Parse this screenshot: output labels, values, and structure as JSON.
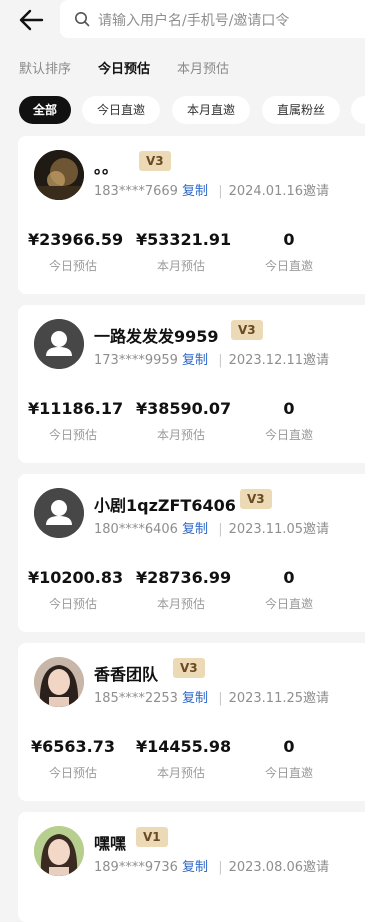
{
  "header": {
    "search_placeholder": "请输入用户名/手机号/邀请口令"
  },
  "sort_tabs": [
    {
      "label": "默认排序",
      "active": false
    },
    {
      "label": "今日预估",
      "active": true
    },
    {
      "label": "本月预估",
      "active": false
    }
  ],
  "filter_chips": [
    {
      "label": "全部",
      "active": true
    },
    {
      "label": "今日直邀",
      "active": false
    },
    {
      "label": "本月直邀",
      "active": false
    },
    {
      "label": "直属粉丝",
      "active": false
    }
  ],
  "copy_label": "复制",
  "stat_labels": [
    "今日预估",
    "本月预估",
    "今日直邀"
  ],
  "members": [
    {
      "name": "。。",
      "level": "V3",
      "phone": "183****7669",
      "invite_date": "2024.01.16邀请",
      "avatar": "dark-photo",
      "stats": [
        "¥23966.59",
        "¥53321.91",
        "0"
      ]
    },
    {
      "name": "一路发发发9959",
      "level": "V3",
      "phone": "173****9959",
      "invite_date": "2023.12.11邀请",
      "avatar": "default-user",
      "stats": [
        "¥11186.17",
        "¥38590.07",
        "0"
      ]
    },
    {
      "name": "小剧1qzZFT6406",
      "level": "V3",
      "phone": "180****6406",
      "invite_date": "2023.11.05邀请",
      "avatar": "default-user",
      "stats": [
        "¥10200.83",
        "¥28736.99",
        "0"
      ]
    },
    {
      "name": "香香团队",
      "level": "V3",
      "phone": "185****2253",
      "invite_date": "2023.11.25邀请",
      "avatar": "woman-photo",
      "stats": [
        "¥6563.73",
        "¥14455.98",
        "0"
      ]
    },
    {
      "name": "嘿嘿",
      "level": "V1",
      "phone": "189****9736",
      "invite_date": "2023.08.06邀请",
      "avatar": "woman-photo-2",
      "stats": []
    }
  ]
}
